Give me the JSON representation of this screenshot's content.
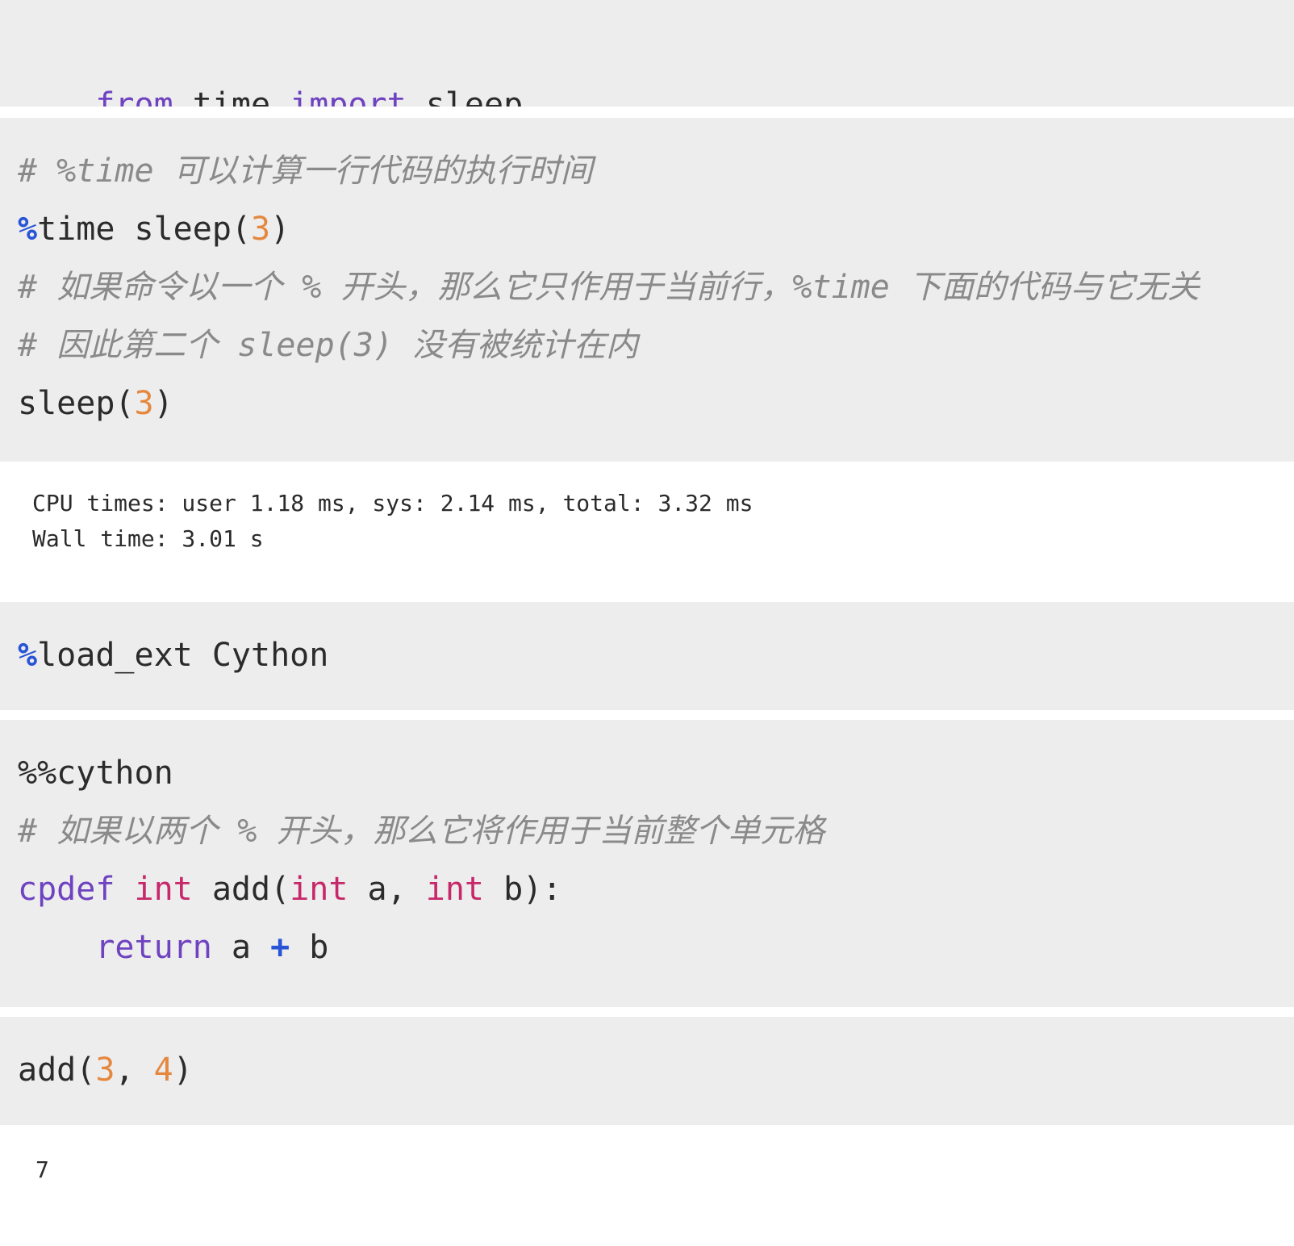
{
  "cells": [
    {
      "type": "code",
      "lines": [
        [
          {
            "t": "from",
            "k": "kw"
          },
          {
            "t": " time ",
            "k": "tx"
          },
          {
            "t": "import",
            "k": "kw"
          },
          {
            "t": " sleep",
            "k": "tx"
          }
        ]
      ]
    },
    {
      "type": "code",
      "lines": [
        [
          {
            "t": "# %time 可以计算一行代码的执行时间",
            "k": "cm"
          }
        ],
        [
          {
            "t": "%",
            "k": "mg"
          },
          {
            "t": "time sleep(",
            "k": "tx"
          },
          {
            "t": "3",
            "k": "num"
          },
          {
            "t": ")",
            "k": "tx"
          }
        ],
        [
          {
            "t": "# 如果命令以一个 % 开头，那么它只作用于当前行，%time 下面的代码与它无关",
            "k": "cm"
          }
        ],
        [
          {
            "t": "# 因此第二个 sleep(3) 没有被统计在内",
            "k": "cm"
          }
        ],
        [
          {
            "t": "sleep(",
            "k": "tx"
          },
          {
            "t": "3",
            "k": "num"
          },
          {
            "t": ")",
            "k": "tx"
          }
        ]
      ]
    },
    {
      "type": "output",
      "lines": [
        "CPU times: user 1.18 ms, sys: 2.14 ms, total: 3.32 ms",
        "Wall time: 3.01 s"
      ]
    },
    {
      "type": "code",
      "lines": [
        [
          {
            "t": "%",
            "k": "mg"
          },
          {
            "t": "load_ext Cython",
            "k": "tx"
          }
        ]
      ]
    },
    {
      "type": "code",
      "lines": [
        [
          {
            "t": "%%cython",
            "k": "tx"
          }
        ],
        [
          {
            "t": "# 如果以两个 % 开头，那么它将作用于当前整个单元格",
            "k": "cm"
          }
        ],
        [
          {
            "t": "cpdef",
            "k": "kw"
          },
          {
            "t": " ",
            "k": "tx"
          },
          {
            "t": "int",
            "k": "ty"
          },
          {
            "t": " add(",
            "k": "tx"
          },
          {
            "t": "int",
            "k": "ty"
          },
          {
            "t": " a, ",
            "k": "tx"
          },
          {
            "t": "int",
            "k": "ty"
          },
          {
            "t": " b):",
            "k": "tx"
          }
        ],
        [
          {
            "t": "    ",
            "k": "tx"
          },
          {
            "t": "return",
            "k": "kw"
          },
          {
            "t": " a ",
            "k": "tx"
          },
          {
            "t": "+",
            "k": "op"
          },
          {
            "t": " b",
            "k": "tx"
          }
        ]
      ]
    },
    {
      "type": "code",
      "lines": [
        [
          {
            "t": "add(",
            "k": "tx"
          },
          {
            "t": "3",
            "k": "num"
          },
          {
            "t": ", ",
            "k": "tx"
          },
          {
            "t": "4",
            "k": "num"
          },
          {
            "t": ")",
            "k": "tx"
          }
        ]
      ]
    },
    {
      "type": "output",
      "lines": [
        "7"
      ]
    }
  ],
  "colors": {
    "cell_background": "#ededed",
    "keyword": "#6f42c1",
    "type": "#c7286a",
    "number": "#e5883f",
    "magic": "#2855d6",
    "comment": "#8a8a8a",
    "text": "#2b2b2b"
  }
}
